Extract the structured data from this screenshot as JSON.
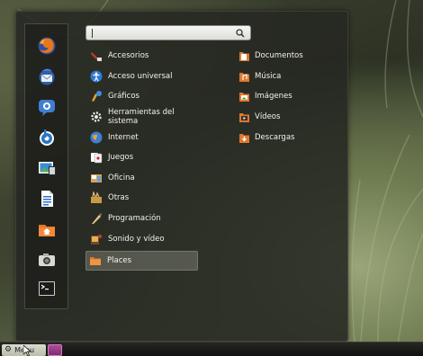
{
  "search": {
    "value": "",
    "placeholder": ""
  },
  "favorites": [
    {
      "icon": "firefox-icon"
    },
    {
      "icon": "thunderbird-icon"
    },
    {
      "icon": "empathy-icon"
    },
    {
      "icon": "banshee-icon"
    },
    {
      "icon": "screenshot-icon"
    },
    {
      "icon": "document-icon"
    },
    {
      "icon": "home-folder-icon"
    },
    {
      "icon": "camera-icon"
    },
    {
      "icon": "terminal-icon"
    }
  ],
  "categories": [
    {
      "label": "Accesorios",
      "icon": "accessories-icon"
    },
    {
      "label": "Acceso universal",
      "icon": "accessibility-icon"
    },
    {
      "label": "Gráficos",
      "icon": "graphics-icon"
    },
    {
      "label": "Herramientas del sistema",
      "icon": "system-tools-icon"
    },
    {
      "label": "Internet",
      "icon": "internet-icon"
    },
    {
      "label": "Juegos",
      "icon": "games-icon"
    },
    {
      "label": "Oficina",
      "icon": "office-icon"
    },
    {
      "label": "Otras",
      "icon": "other-icon"
    },
    {
      "label": "Programación",
      "icon": "programming-icon"
    },
    {
      "label": "Sonido y vídeo",
      "icon": "sound-video-icon"
    },
    {
      "label": "Places",
      "icon": "places-folder-icon",
      "selected": true
    }
  ],
  "places": [
    {
      "label": "Documentos",
      "icon": "documents-folder-icon"
    },
    {
      "label": "Música",
      "icon": "music-folder-icon"
    },
    {
      "label": "Imágenes",
      "icon": "pictures-folder-icon"
    },
    {
      "label": "Vídeos",
      "icon": "videos-folder-icon"
    },
    {
      "label": "Descargas",
      "icon": "downloads-folder-icon"
    }
  ],
  "panel": {
    "menu_label": "Menu"
  },
  "colors": {
    "panel_bg": "#262822",
    "text": "#f2f2ee",
    "folder": "#e0782c",
    "selected_bg": "#787a70"
  }
}
